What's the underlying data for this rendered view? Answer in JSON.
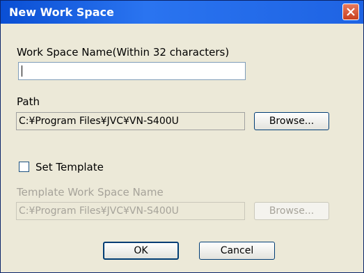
{
  "dialog": {
    "title": "New Work Space",
    "close_icon": "close-x-icon",
    "colors": {
      "title_bar": "#0a4fd4",
      "close_button": "#c8401f",
      "background": "#ece9d8"
    }
  },
  "name_section": {
    "label": "Work Space Name(Within 32 characters)",
    "value": ""
  },
  "path_section": {
    "label": "Path",
    "value": "C:¥Program Files¥JVC¥VN-S400U",
    "browse_label": "Browse..."
  },
  "template": {
    "checkbox_label": "Set Template",
    "checked": false,
    "name_label": "Template Work Space Name",
    "value": "C:¥Program Files¥JVC¥VN-S400U",
    "browse_label": "Browse..."
  },
  "footer": {
    "ok_label": "OK",
    "cancel_label": "Cancel"
  }
}
